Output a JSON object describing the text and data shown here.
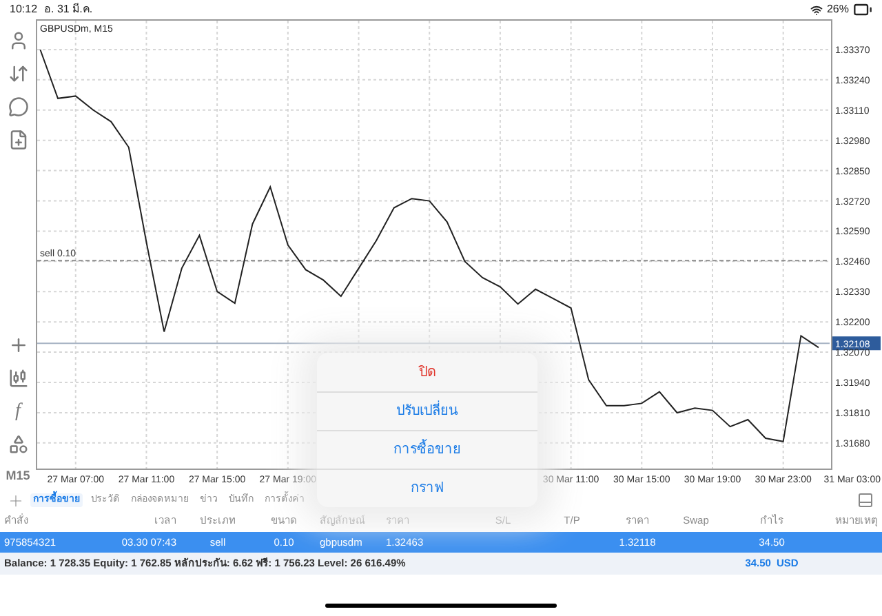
{
  "status_bar": {
    "time": "10:12",
    "date": "อ. 31 มี.ค.",
    "battery": "26%"
  },
  "toolbar": [
    {
      "kind": "icon"
    },
    {
      "kind": "icon"
    },
    {
      "kind": "icon"
    },
    {
      "kind": "icon"
    },
    {
      "kind": "icon"
    },
    {
      "kind": "icon"
    },
    {
      "kind": "text",
      "text": "f"
    },
    {
      "kind": "icon"
    },
    {
      "kind": "text",
      "text": "M15"
    }
  ],
  "chart": {
    "chart_data": {
      "type": "line",
      "title": "GBPUSDm, M15",
      "grid": true,
      "ylim": [
        1.3157,
        1.335
      ],
      "categories": [
        null,
        null,
        "27 Mar 07:00",
        null,
        null,
        null,
        "27 Mar 11:00",
        null,
        null,
        null,
        "27 Mar 15:00",
        null,
        null,
        null,
        "27 Mar 19:00",
        null,
        null,
        null,
        null,
        null,
        null,
        null,
        null,
        null,
        null,
        null,
        null,
        null,
        null,
        null,
        "30 Mar 11:00",
        null,
        null,
        null,
        "30 Mar 15:00",
        null,
        null,
        null,
        "30 Mar 19:00",
        null,
        null,
        null,
        "30 Mar 23:00",
        null,
        null,
        null,
        "31 Mar 03:00"
      ],
      "series": [
        {
          "color": "#222222",
          "values": [
            1.3337,
            1.3316,
            1.3317,
            1.3311,
            1.3306,
            1.3295,
            1.32543,
            1.32158,
            1.3243,
            1.32572,
            1.3233,
            1.3228,
            1.3262,
            1.3278,
            1.3253,
            1.32424,
            1.3238,
            1.3231,
            1.3243,
            1.3255,
            1.3269,
            1.3273,
            1.3272,
            1.3263,
            1.3246,
            1.3239,
            1.3235,
            1.32277,
            1.3234,
            1.323,
            1.3226,
            1.31952,
            1.3184,
            1.3184,
            1.3185,
            1.319,
            1.3181,
            1.3183,
            1.3182,
            1.3175,
            1.3178,
            1.317,
            1.31686,
            1.3214,
            1.3209,
            null,
            null
          ]
        }
      ],
      "yticks": [
        {
          "value": 1.3337,
          "label": "1.33370"
        },
        {
          "value": 1.3324,
          "label": "1.33240"
        },
        {
          "value": 1.3311,
          "label": "1.33110"
        },
        {
          "value": 1.3298,
          "label": "1.32980"
        },
        {
          "value": 1.3285,
          "label": "1.32850"
        },
        {
          "value": 1.3272,
          "label": "1.32720"
        },
        {
          "value": 1.3259,
          "label": "1.32590"
        },
        {
          "value": 1.3246,
          "label": "1.32460"
        },
        {
          "value": 1.3233,
          "label": "1.32330"
        },
        {
          "value": 1.322,
          "label": "1.32200"
        },
        {
          "value": 1.3207,
          "label": "1.32070"
        },
        {
          "value": 1.3194,
          "label": "1.31940"
        },
        {
          "value": 1.3181,
          "label": "1.31810"
        },
        {
          "value": 1.3168,
          "label": "1.31680"
        }
      ],
      "ref_lines": [
        {
          "axis": "y",
          "value": 1.32463,
          "label": "sell 0.10"
        },
        {
          "axis": "y",
          "value": 1.32108,
          "label": "1.32108"
        }
      ]
    }
  },
  "tabs": [
    {
      "label": "การซื้อขาย",
      "selected": true
    },
    {
      "label": "ประวัติ",
      "selected": false
    },
    {
      "label": "กล่องจดหมาย",
      "selected": false
    },
    {
      "label": "ข่าว",
      "selected": false
    },
    {
      "label": "บันทึก",
      "selected": false
    },
    {
      "label": "การตั้งค่า",
      "selected": false
    }
  ],
  "table": {
    "columns": [
      "คำสั่ง",
      "เวลา",
      "ประเภท",
      "ขนาด",
      "สัญลักษณ์",
      "ราคา",
      "S/L",
      "T/P",
      "ราคา",
      "Swap",
      "กำไร",
      "หมายเหตุ"
    ],
    "rows": [
      {
        "selected": true,
        "cells": [
          "975854321",
          "03.30 07:43",
          "sell",
          "0.10",
          "gbpusdm",
          "1.32463",
          "",
          "",
          "1.32118",
          "",
          "34.50",
          ""
        ]
      }
    ]
  },
  "summary": {
    "text": "Balance: 1 728.35 Equity: 1 762.85 หลักประกัน: 6.62 ฟรี: 1 756.23 Level: 26 616.49%",
    "profit": "34.50",
    "currency": "USD"
  },
  "context_menu": [
    {
      "label": "ปิด",
      "kind": "destructive"
    },
    {
      "label": "ปรับเปลี่ยน",
      "kind": "normal"
    },
    {
      "label": "การซื้อขาย",
      "kind": "normal"
    },
    {
      "label": "กราฟ",
      "kind": "normal"
    }
  ]
}
